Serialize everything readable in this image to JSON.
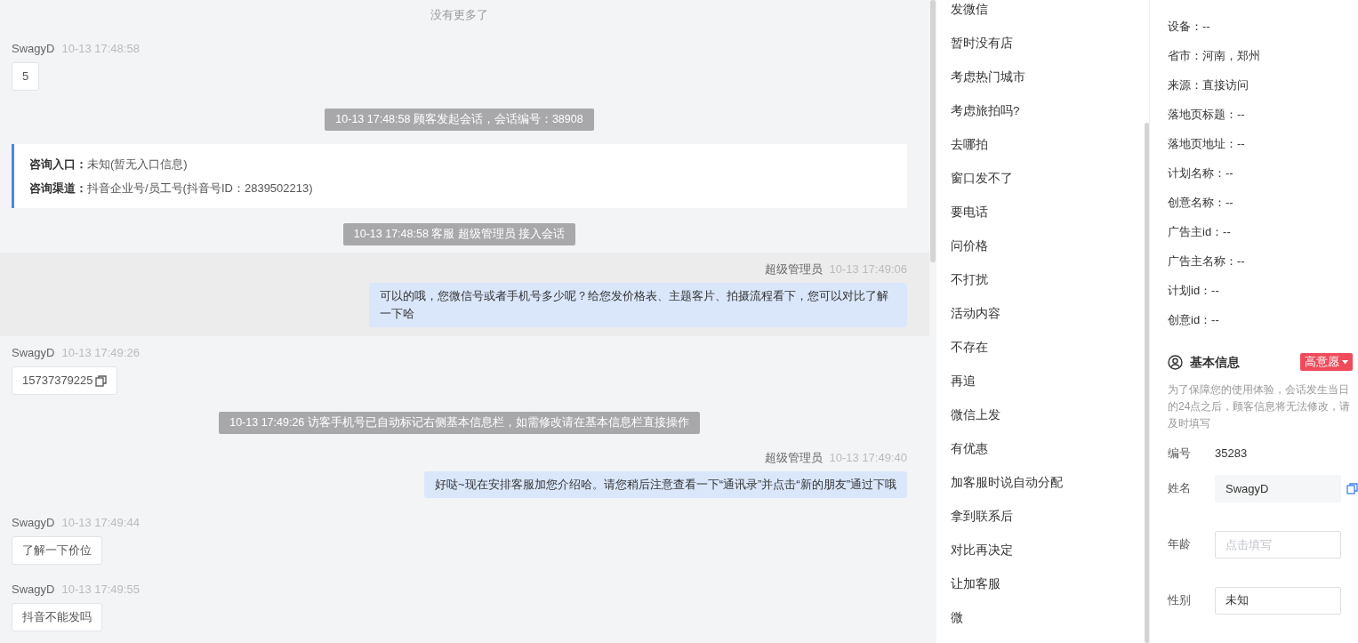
{
  "chat": {
    "items": [
      {
        "kind": "notice",
        "text": "没有更多了"
      },
      {
        "kind": "customer",
        "name": "SwagyD",
        "time": "10-13 17:48:58",
        "text": "5",
        "copyable": false
      },
      {
        "kind": "system",
        "text": "10-13 17:48:58 顾客发起会话，会话编号：38908"
      },
      {
        "kind": "entry",
        "lines": [
          "**咨询入口：**未知(暂无入口信息)",
          "**咨询渠道：**抖音企业号/员工号(抖音号ID：2839502213)"
        ]
      },
      {
        "kind": "system",
        "text": "10-13 17:48:58 客服 超级管理员 接入会话"
      },
      {
        "kind": "agent",
        "name": "超级管理员",
        "time": "10-13 17:49:06",
        "text": "可以的哦，您微信号或者手机号多少呢？给您发价格表、主题客片、拍摄流程看下，您可以对比了解一下哈",
        "highlighted": true
      },
      {
        "kind": "customer",
        "name": "SwagyD",
        "time": "10-13 17:49:26",
        "text": "15737379225",
        "copyable": true
      },
      {
        "kind": "system",
        "text": "10-13 17:49:26 访客手机号已自动标记右侧基本信息栏，如需修改请在基本信息栏直接操作"
      },
      {
        "kind": "agent",
        "name": "超级管理员",
        "time": "10-13 17:49:40",
        "text": "好哒~现在安排客服加您介绍哈。请您稍后注意查看一下“通讯录”并点击“新的朋友”通过下哦",
        "highlighted": false
      },
      {
        "kind": "customer",
        "name": "SwagyD",
        "time": "10-13 17:49:44",
        "text": "了解一下价位",
        "copyable": false
      },
      {
        "kind": "customer",
        "name": "SwagyD",
        "time": "10-13 17:49:55",
        "text": "抖音不能发吗",
        "copyable": false
      }
    ]
  },
  "quick_replies": [
    "发微信",
    "暂时没有店",
    "考虑热门城市",
    "考虑旅拍吗?",
    "去哪拍",
    "窗口发不了",
    "要电话",
    "问价格",
    "不打扰",
    "活动内容",
    "不存在",
    "再追",
    "微信上发",
    "有优惠",
    "加客服时说自动分配",
    "拿到联系后",
    "对比再决定",
    "让加客服",
    "微"
  ],
  "visitor_info": [
    "设备：--",
    "省市：河南，郑州",
    "来源：直接访问",
    "落地页标题：--",
    "落地页地址：--",
    "计划名称：--",
    "创意名称：--",
    "广告主id：--",
    "广告主名称：--",
    "计划id：--",
    "创意id：--"
  ],
  "basic_info": {
    "title": "基本信息",
    "intent_tag": "高意愿",
    "note": "为了保障您的使用体验，会话发生当日的24点之后，顾客信息将无法修改，请及时填写",
    "fields": [
      {
        "kind": "text",
        "label": "编号",
        "value": "35283"
      },
      {
        "kind": "input",
        "label": "姓名",
        "value": "SwagyD",
        "disabled": true,
        "copyable": true
      },
      {
        "kind": "input",
        "label": "年龄",
        "placeholder": "点击填写",
        "disabled": false,
        "copyable": false
      },
      {
        "kind": "input",
        "label": "性别",
        "value": "未知",
        "disabled": false,
        "copyable": false
      }
    ]
  }
}
